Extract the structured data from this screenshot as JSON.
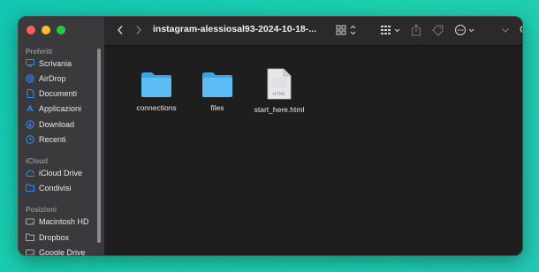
{
  "window": {
    "title": "instagram-alessiosal93-2024-10-18-..."
  },
  "sidebar": {
    "sections": [
      {
        "label": "Preferiti",
        "items": [
          {
            "label": "Scrivania",
            "icon": "desktop-icon"
          },
          {
            "label": "AirDrop",
            "icon": "airdrop-icon"
          },
          {
            "label": "Documenti",
            "icon": "document-icon"
          },
          {
            "label": "Applicazioni",
            "icon": "applications-icon"
          },
          {
            "label": "Download",
            "icon": "download-icon"
          },
          {
            "label": "Recenti",
            "icon": "clock-icon"
          }
        ]
      },
      {
        "label": "iCloud",
        "items": [
          {
            "label": "iCloud Drive",
            "icon": "cloud-icon"
          },
          {
            "label": "Condivisi",
            "icon": "shared-folder-icon"
          }
        ]
      },
      {
        "label": "Posizioni",
        "items": [
          {
            "label": "Macintosh HD",
            "icon": "disk-icon"
          },
          {
            "label": "Dropbox",
            "icon": "folder-icon"
          },
          {
            "label": "Google Drive",
            "icon": "disk-icon"
          }
        ]
      }
    ]
  },
  "files": [
    {
      "name": "connections",
      "kind": "folder"
    },
    {
      "name": "files",
      "kind": "folder"
    },
    {
      "name": "start_here.html",
      "kind": "html",
      "badge": "HTML"
    }
  ],
  "colors": {
    "accent": "#2f8cff",
    "folder": "#54b9f2",
    "background": "#1ecfae"
  }
}
